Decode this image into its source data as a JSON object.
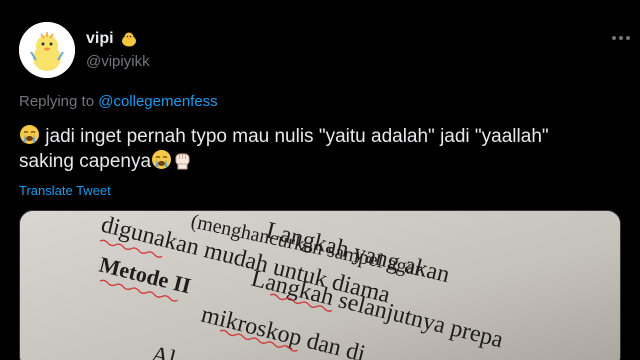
{
  "author": {
    "display_name": "vipi",
    "handle": "@vipiyikk",
    "name_emoji": "chick-emoji",
    "avatar": "duck-avatar"
  },
  "reply": {
    "prefix": "Replying to ",
    "mention": "@collegemenfess"
  },
  "tweet": {
    "text_line1": " jadi inget pernah typo mau nulis \"yaitu adalah\" jadi \"yaallah\"",
    "text_line2": "saking capenya",
    "emojis": [
      "crying-face-emoji",
      "crying-face-emoji",
      "raised-fist-emoji"
    ],
    "translate_label": "Translate Tweet"
  },
  "media": {
    "description_icon": "photo-of-printed-document",
    "doc_lines": [
      "(menghancurkan sampel agar",
      "Langkah  yang  akan",
      "digunakan  mudah  untuk  diama",
      "Metode II",
      "Langkah selanjutnya prepa",
      "mikroskop dan di",
      "Al"
    ]
  },
  "colors": {
    "background": "#000000",
    "text": "#e7e9ea",
    "muted": "#71767b",
    "link": "#1d9bf0"
  }
}
